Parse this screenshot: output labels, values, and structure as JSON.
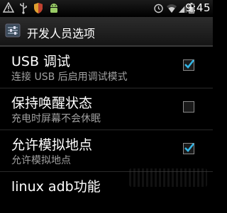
{
  "status_bar": {
    "time": "9:45",
    "left_icons": [
      "warning-icon",
      "usb-icon",
      "shield-icon",
      "android-icon"
    ],
    "right_icons": [
      "alarm-icon",
      "wifi-icon",
      "signal-icon",
      "battery-icon"
    ]
  },
  "action_bar": {
    "title": "开发人员选项",
    "icon": "settings-icon"
  },
  "settings": [
    {
      "title": "USB 调试",
      "summary": "连接 USB 后启用调试模式",
      "checked": true
    },
    {
      "title": "保持唤醒状态",
      "summary": "充电时屏幕不会休眠",
      "checked": false
    },
    {
      "title": "允许模拟地点",
      "summary": "允许模拟地点",
      "checked": true
    },
    {
      "title": "linux adb功能",
      "summary": ""
    }
  ],
  "colors": {
    "accent": "#33b5e5",
    "summary_text": "#a0a0a0"
  }
}
